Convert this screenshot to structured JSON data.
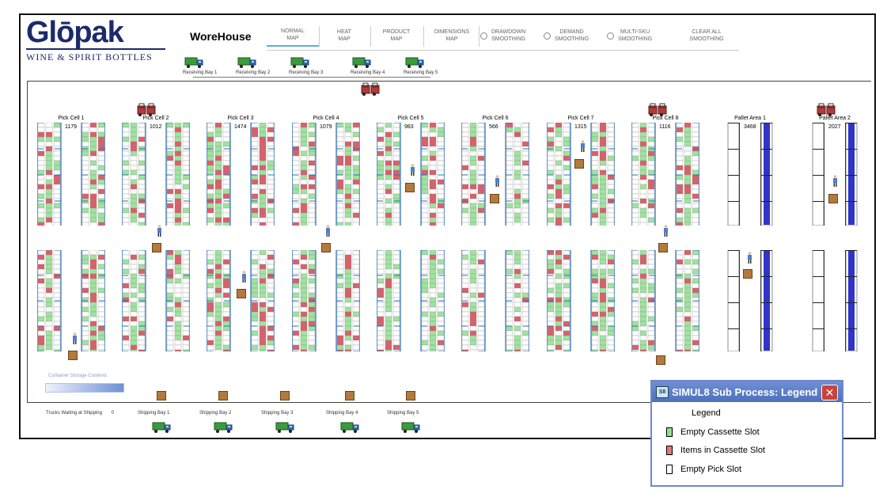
{
  "logo": {
    "word": "Glōpak",
    "tagline": "WINE & SPIRIT BOTTLES"
  },
  "title": "WoreHouse",
  "menu": [
    {
      "label": "NORMAL\nMAP",
      "active": true
    },
    {
      "label": "HEAT\nMAP"
    },
    {
      "label": "PRODUCT\nMAP"
    },
    {
      "label": "DIMENSIONS\nMAP"
    },
    {
      "label": "DRAWDOWN\nSMOOTHING",
      "radio": true
    },
    {
      "label": "DEMAND\nSMOOTHING",
      "radio": true
    },
    {
      "label": "MULTI-SKU\nSMOOTHING",
      "radio": true
    },
    {
      "label": "CLEAR ALL\nSMOOTHING"
    }
  ],
  "receiving_bays": [
    "Receiving Bay 1",
    "Receiving Bay 2",
    "Receiving Bay 3",
    "Receiving Bay 4",
    "Receiving Bay 5"
  ],
  "shipping_bays": [
    "Shipping Bay 1",
    "Shipping Bay 2",
    "Shipping Bay 3",
    "Shipping Bay 4",
    "Shipping Bay 5"
  ],
  "cells": [
    {
      "name": "Pick Cell 1",
      "count": "1179",
      "type": "pick"
    },
    {
      "name": "Pick Cell 2",
      "count": "1012",
      "type": "pick"
    },
    {
      "name": "Pick Cell 3",
      "count": "1474",
      "type": "pick"
    },
    {
      "name": "Pick Cell 4",
      "count": "1079",
      "type": "pick"
    },
    {
      "name": "Pick Cell 5",
      "count": "983",
      "type": "pick"
    },
    {
      "name": "Pick Cell 6",
      "count": "566",
      "type": "pick"
    },
    {
      "name": "Pick Cell 7",
      "count": "1315",
      "type": "pick"
    },
    {
      "name": "Pick Cell 8",
      "count": "1116",
      "type": "pick"
    },
    {
      "name": "Pallet Area 1",
      "count": "3468",
      "type": "pallet"
    },
    {
      "name": "Pallet Area 2",
      "count": "2027",
      "type": "pallet"
    }
  ],
  "container_storage_label": "Container Storage Contents",
  "trucks_waiting": {
    "label": "Trucks Waiting at Shipping",
    "value": "0"
  },
  "legend": {
    "title": "SIMUL8 Sub Process: Legend",
    "app_icon": "S8",
    "close": "✕",
    "heading": "Legend",
    "items": [
      {
        "label": "Empty Cassette Slot",
        "color": "#8fe08f"
      },
      {
        "label": "Items in Cassette Slot",
        "color": "#e07a7a"
      },
      {
        "label": "Empty Pick Slot",
        "color": "#ffffff"
      }
    ]
  },
  "colors": {
    "green": "#9fe39f",
    "red": "#d9606a",
    "blue": "#2f35c8",
    "rack_line": "#2a6fb5",
    "brand": "#1b2a6b"
  }
}
